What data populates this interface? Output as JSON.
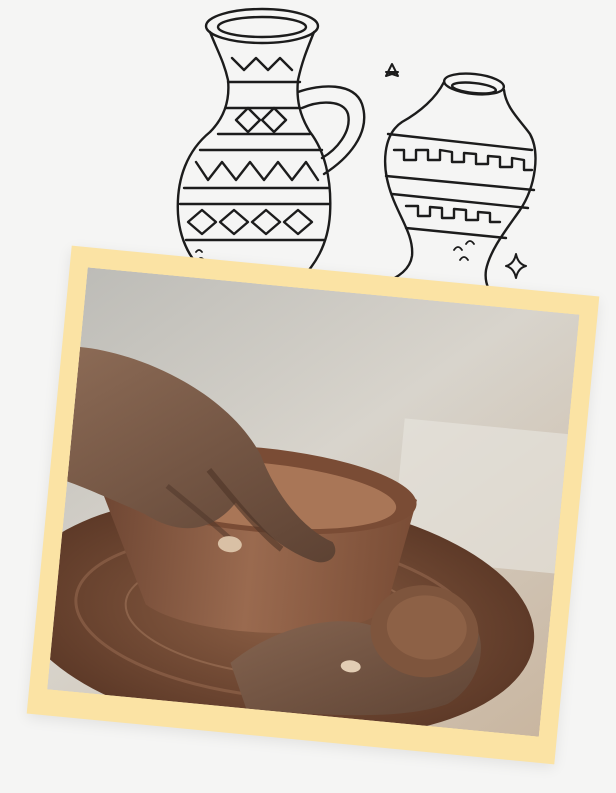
{
  "scene": {
    "frame_color": "#fbe3a4",
    "background_color": "#f5f5f4",
    "doodle_stroke": "#1c1c1c",
    "icons": [
      "jug-doodle-icon",
      "vase-doodle-icon",
      "star-icon",
      "sparkle-icon"
    ],
    "photo_subject": "hands-shaping-clay-bowl-on-pottery-wheel"
  }
}
